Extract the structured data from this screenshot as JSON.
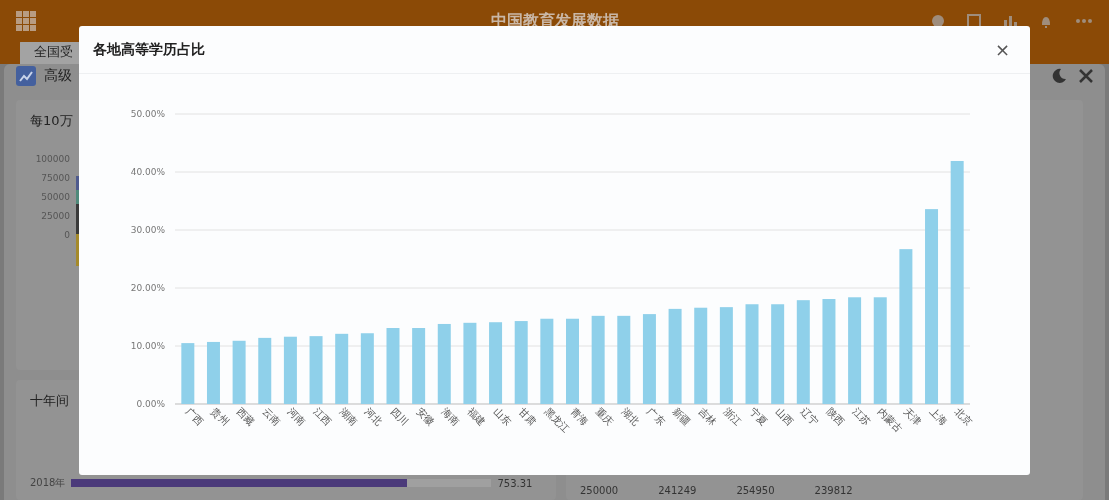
{
  "header": {
    "title": "中国教育发展数据"
  },
  "tabs": [
    {
      "label": "全国受",
      "selected": true
    }
  ],
  "panel": {
    "title": "高级"
  },
  "left_card": {
    "title": "每10万",
    "y_ticks": [
      "100000",
      "75000",
      "50000",
      "25000",
      "0"
    ]
  },
  "bottom_card": {
    "title": "十年间",
    "rows": [
      {
        "label": "2018年",
        "value": "753.31",
        "level": 0.8
      }
    ]
  },
  "line_card": {
    "y_tick": "250000",
    "labels": [
      "241249",
      "254950",
      "239812"
    ]
  },
  "modal": {
    "title": "各地高等学历占比",
    "close": "×",
    "chart_data": {
      "type": "bar",
      "grid": true,
      "categories": [
        "广西",
        "贵州",
        "西藏",
        "云南",
        "河南",
        "江西",
        "湖南",
        "河北",
        "四川",
        "安徽",
        "海南",
        "福建",
        "山东",
        "甘肃",
        "黑龙江",
        "青海",
        "重庆",
        "湖北",
        "广东",
        "新疆",
        "吉林",
        "浙江",
        "宁夏",
        "山西",
        "辽宁",
        "陕西",
        "江苏",
        "内蒙古",
        "天津",
        "上海",
        "北京"
      ],
      "series": [
        {
          "color": "#8fd0ea",
          "values": [
            10.5,
            10.7,
            10.9,
            11.4,
            11.6,
            11.7,
            12.1,
            12.2,
            13.1,
            13.1,
            13.8,
            14.0,
            14.1,
            14.3,
            14.7,
            14.7,
            15.2,
            15.2,
            15.5,
            16.4,
            16.6,
            16.7,
            17.2,
            17.2,
            17.9,
            18.1,
            18.4,
            18.4,
            26.7,
            33.6,
            41.9
          ]
        }
      ],
      "ylim": [
        0,
        50
      ],
      "yticks": [
        {
          "value": 0,
          "label": "0.00%"
        },
        {
          "value": 10,
          "label": "10.00%"
        },
        {
          "value": 20,
          "label": "20.00%"
        },
        {
          "value": 30,
          "label": "30.00%"
        },
        {
          "value": 40,
          "label": "40.00%"
        },
        {
          "value": 50,
          "label": "50.00%"
        }
      ]
    }
  }
}
